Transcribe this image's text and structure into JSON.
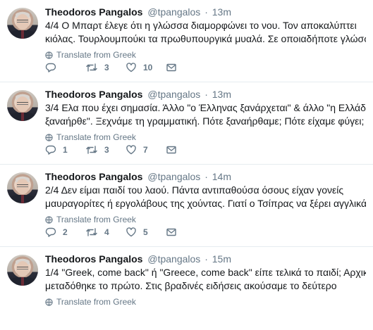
{
  "colors": {
    "text": "#14171a",
    "secondary": "#657786",
    "divider": "#e6ecf0"
  },
  "tweets": [
    {
      "name": "Theodoros Pangalos",
      "handle": "@tpangalos",
      "dot": "·",
      "time": "13m",
      "lines": [
        "4/4 Ο Μπαρτ έλεγε ότι η γλώσσα διαμορφώνει το νου. Τον αποκαλύπτει",
        "κιόλας. Τουρλουμπούκι τα πρωθυπουργικά μυαλά. Σε οποιαδήποτε γλώσσα..."
      ],
      "translate": "Translate from Greek",
      "replies": "",
      "retweets": "3",
      "likes": "10"
    },
    {
      "name": "Theodoros Pangalos",
      "handle": "@tpangalos",
      "dot": "·",
      "time": "13m",
      "lines": [
        "3/4 Ελα που έχει σημασία. Άλλο \"ο Έλληνας ξανάρχεται\" & άλλο \"η Ελλάδα",
        "ξαναήρθε\". Ξεχνάμε τη γραμματική. Πότε ξαναήρθαμε; Πότε είχαμε φύγει;"
      ],
      "translate": "Translate from Greek",
      "replies": "1",
      "retweets": "3",
      "likes": "7"
    },
    {
      "name": "Theodoros Pangalos",
      "handle": "@tpangalos",
      "dot": "·",
      "time": "14m",
      "lines": [
        "2/4 Δεν είμαι παιδί του λαού. Πάντα αντιπαθούσα όσους είχαν γονείς",
        "μαυραγορίτες ή εργολάβους της χούντας. Γιατί ο Τσίπρας να ξέρει αγγλικά;"
      ],
      "translate": "Translate from Greek",
      "replies": "2",
      "retweets": "4",
      "likes": "5"
    },
    {
      "name": "Theodoros Pangalos",
      "handle": "@tpangalos",
      "dot": "·",
      "time": "15m",
      "lines": [
        "1/4 \"Greek, come back\" ή \"Greece, come back\" είπε τελικά το παιδί; Αρχικά",
        "μεταδόθηκε το πρώτο. Στις βραδινές ειδήσεις ακούσαμε το δεύτερο"
      ],
      "translate": "Translate from Greek",
      "replies": "",
      "retweets": "",
      "likes": ""
    }
  ]
}
